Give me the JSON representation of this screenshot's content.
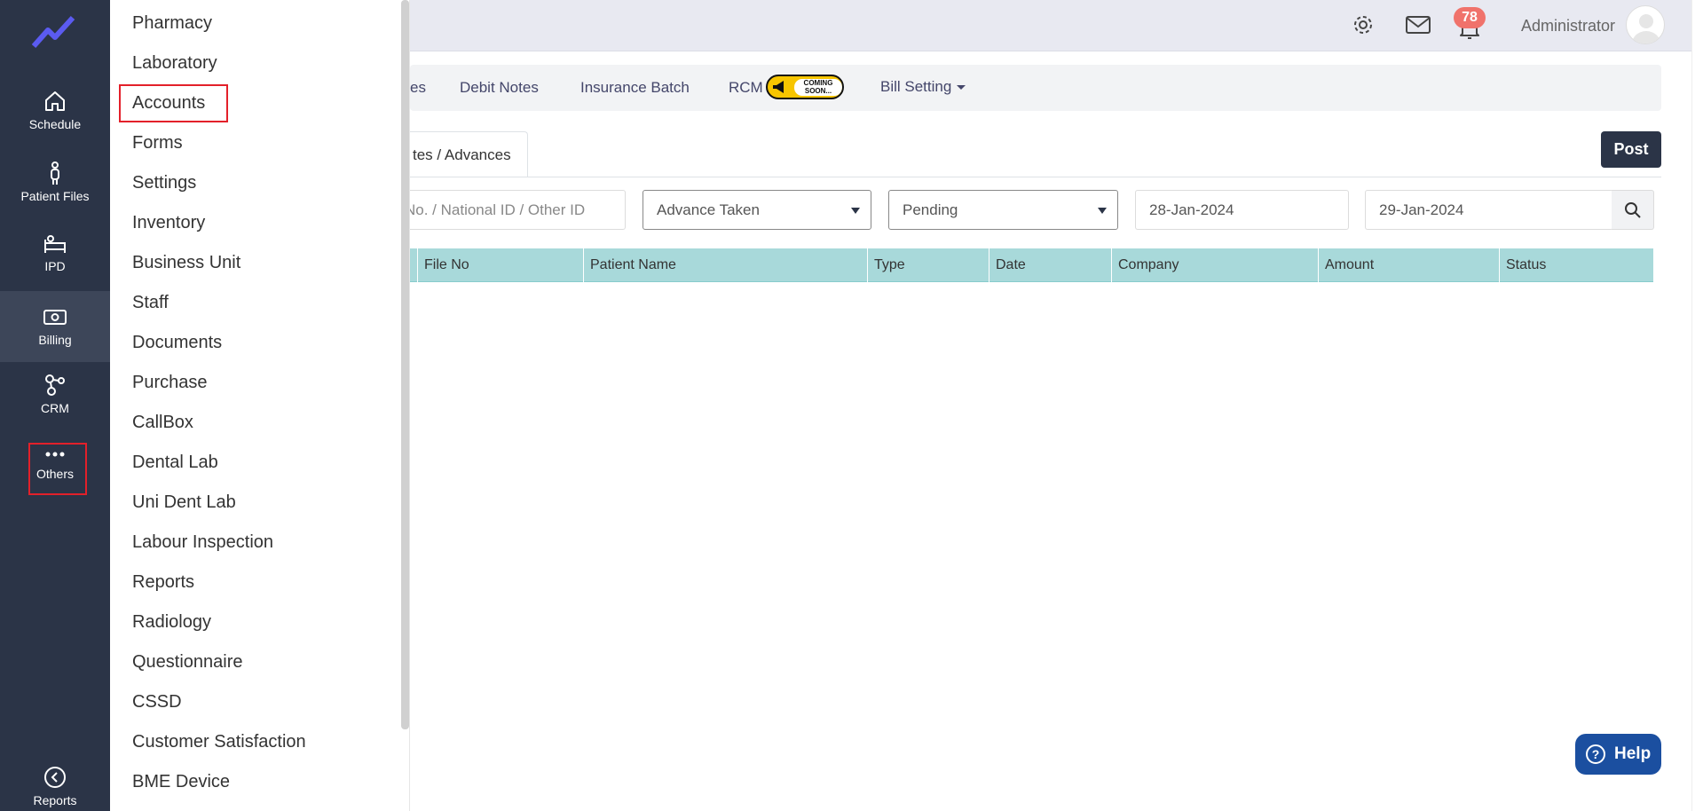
{
  "sidebar": {
    "items": [
      {
        "label": "Schedule",
        "icon": "home-icon"
      },
      {
        "label": "Patient Files",
        "icon": "person-icon"
      },
      {
        "label": "IPD",
        "icon": "bed-icon"
      },
      {
        "label": "Billing",
        "icon": "money-icon"
      },
      {
        "label": "CRM",
        "icon": "network-icon"
      },
      {
        "label": "Others",
        "icon": "more-dots-icon"
      }
    ],
    "bottom": {
      "label": "Reports",
      "icon": "chevron-left-circle-icon"
    }
  },
  "menu": {
    "items": [
      "Pharmacy",
      "Laboratory",
      "Accounts",
      "Forms",
      "Settings",
      "Inventory",
      "Business Unit",
      "Staff",
      "Documents",
      "Purchase",
      "CallBox",
      "Dental Lab",
      "Uni Dent Lab",
      "Labour Inspection",
      "Reports",
      "Radiology",
      "Questionnaire",
      "CSSD",
      "Customer Satisfaction",
      "BME Device"
    ]
  },
  "header": {
    "notification_count": "78",
    "user_name": "Administrator"
  },
  "subnav": {
    "partial": "es",
    "debit_notes": "Debit Notes",
    "insurance_batch": "Insurance Batch",
    "rcm": "RCM",
    "coming_soon": "COMING SOON...",
    "bill_setting": "Bill Setting"
  },
  "tabs": {
    "active": "tes / Advances"
  },
  "actions": {
    "post": "Post"
  },
  "filters": {
    "id_placeholder": "No. / National ID / Other ID",
    "advance_type": "Advance Taken",
    "status": "Pending",
    "from_date": "28-Jan-2024",
    "to_date": "29-Jan-2024"
  },
  "table": {
    "columns": [
      "File No",
      "Patient Name",
      "Type",
      "Date",
      "Company",
      "Amount",
      "Status"
    ]
  },
  "help": {
    "label": "Help"
  },
  "colors": {
    "sidebar_bg": "#2b3447",
    "table_header": "#a8d9da",
    "highlight": "#e3202a",
    "help_bg": "#1b4fa0"
  }
}
